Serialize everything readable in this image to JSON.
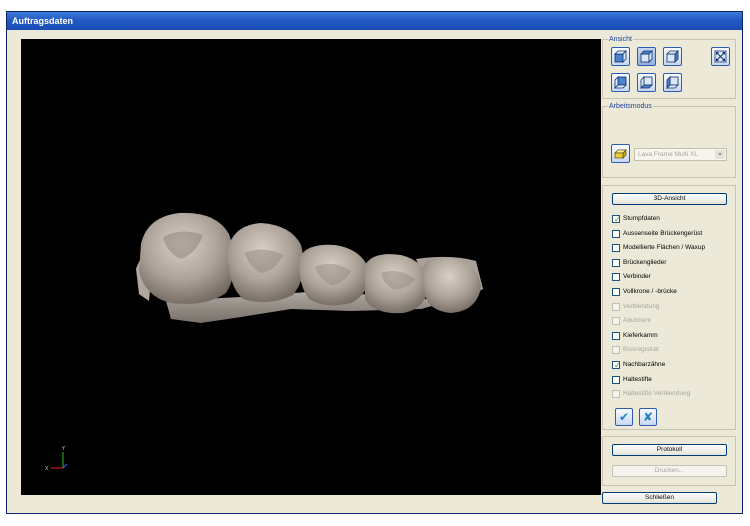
{
  "window": {
    "title": "Auftragsdaten"
  },
  "viewport": {
    "axis_x_label": "X",
    "axis_y_label": "Y",
    "model_icon": "dental-bridge-3d-model"
  },
  "ansicht": {
    "title": "Ansicht",
    "buttons": [
      {
        "name": "view-front-icon"
      },
      {
        "name": "view-top-icon"
      },
      {
        "name": "view-right-icon"
      },
      {
        "name": "view-back-icon"
      },
      {
        "name": "view-bottom-icon"
      },
      {
        "name": "view-left-icon"
      },
      {
        "name": "fit-view-icon"
      }
    ]
  },
  "arbeitsmodus": {
    "title": "Arbeitsmodus",
    "icon": "block-material-icon",
    "combo_value": "Lava Frame Multi XL"
  },
  "layers": {
    "view_button": "3D-Ansicht",
    "items": [
      {
        "label": "Stumpfdaten",
        "checked": true,
        "enabled": true
      },
      {
        "label": "Aussenseite Brückengerüst",
        "checked": false,
        "enabled": true
      },
      {
        "label": "Modellierte Flächen / Waxup",
        "checked": false,
        "enabled": true
      },
      {
        "label": "Brückenglieder",
        "checked": false,
        "enabled": true
      },
      {
        "label": "Verbinder",
        "checked": false,
        "enabled": true
      },
      {
        "label": "Vollkrone / -brücke",
        "checked": false,
        "enabled": true
      },
      {
        "label": "Verblendung",
        "checked": false,
        "enabled": false
      },
      {
        "label": "Abutment",
        "checked": false,
        "enabled": false
      },
      {
        "label": "Kieferkamm",
        "checked": false,
        "enabled": true
      },
      {
        "label": "Bissregistrat",
        "checked": false,
        "enabled": false
      },
      {
        "label": "Nachbarzähne",
        "checked": true,
        "enabled": true
      },
      {
        "label": "Haltestifte",
        "checked": false,
        "enabled": true
      },
      {
        "label": "Haltestifte Verblendung",
        "checked": false,
        "enabled": false
      }
    ],
    "check_all_icon": "check-all-icon",
    "uncheck_all_icon": "uncheck-all-icon"
  },
  "bottom": {
    "protokoll": "Protokoll",
    "drucken": "Drucken...",
    "schliessen": "Schließen"
  },
  "colors": {
    "title_bar": "#2459c4",
    "face": "#ece9d8",
    "viewport_bg": "#000000",
    "tooth": "#b7ada4",
    "check": "#21a121",
    "uncheck": "#1f7fc0"
  }
}
